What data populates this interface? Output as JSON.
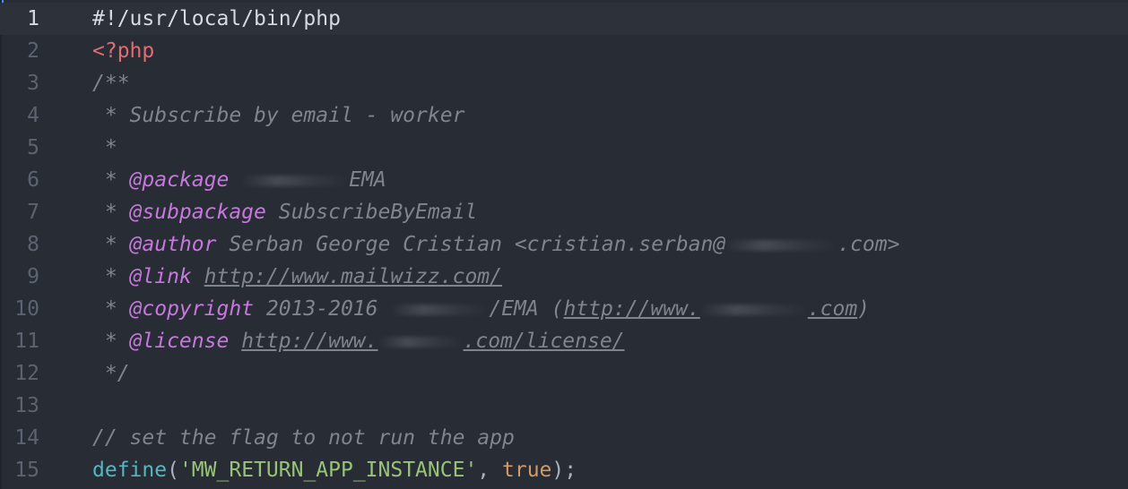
{
  "editor": {
    "lines": [
      {
        "n": "1",
        "shebang": "#!/usr/local/bin/php"
      },
      {
        "n": "2",
        "open_tag": "<?php"
      },
      {
        "n": "3",
        "text": "/**"
      },
      {
        "n": "4",
        "text": " * Subscribe by email - worker"
      },
      {
        "n": "5",
        "text": " *"
      },
      {
        "n": "6",
        "star": " * ",
        "tag": "@package",
        "pre": " ",
        "post": "EMA"
      },
      {
        "n": "7",
        "star": " * ",
        "tag": "@subpackage",
        "rest": " SubscribeByEmail"
      },
      {
        "n": "8",
        "star": " * ",
        "tag": "@author",
        "pre": " Serban George Cristian <cristian.serban@",
        "post": ".com>"
      },
      {
        "n": "9",
        "star": " * ",
        "tag": "@link",
        "sp": " ",
        "url": "http://www.mailwizz.com/"
      },
      {
        "n": "10",
        "star": " * ",
        "tag": "@copyright",
        "pre": " 2013-2016 ",
        "mid": "/EMA (",
        "url_pre": "http://www.",
        "url_post": ".com",
        "close": ")"
      },
      {
        "n": "11",
        "star": " * ",
        "tag": "@license",
        "sp": " ",
        "url_pre": "http://www.",
        "url_post": ".com/license/"
      },
      {
        "n": "12",
        "text": " */"
      },
      {
        "n": "13",
        "text": ""
      },
      {
        "n": "14",
        "text": "// set the flag to not run the app"
      },
      {
        "n": "15",
        "fn": "define",
        "p1": "(",
        "str": "'MW_RETURN_APP_INSTANCE'",
        "p2": ", ",
        "bool": "true",
        "p3": ");"
      }
    ]
  },
  "colors": {
    "background": "#282c34",
    "cursor_line": "#2c313a",
    "comment": "#7f848e",
    "doc_tag": "#c678dd",
    "php_tag": "#e06c75",
    "function": "#56b6c2",
    "string": "#98c379",
    "boolean": "#d19a66"
  }
}
